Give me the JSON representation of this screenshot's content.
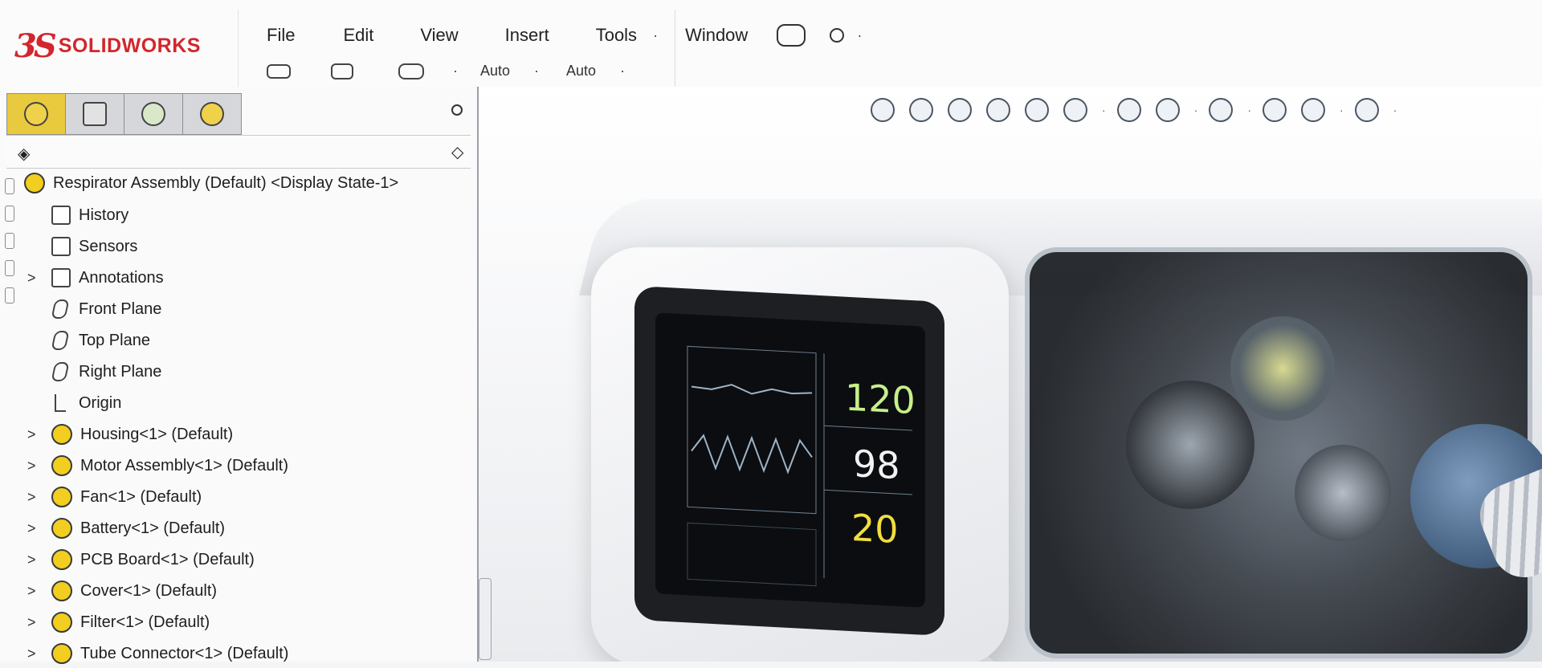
{
  "app": {
    "logo_ds": "3S",
    "logo_text": "SOLIDWORKS",
    "brand_color": "#d3262c"
  },
  "menu": {
    "items": [
      "File",
      "Edit",
      "View",
      "Insert",
      "Tools",
      "Window"
    ],
    "extra": [
      "·",
      "·"
    ],
    "sub_items": [
      "Auto",
      "Auto"
    ]
  },
  "feature_tree": {
    "root_label": "Respirator Assembly (Default) <Display State-1>",
    "rows": [
      {
        "label": "History",
        "icon": "history-icon",
        "expandable": false
      },
      {
        "label": "Sensors",
        "icon": "sensors-icon",
        "expandable": false
      },
      {
        "label": "Annotations",
        "icon": "annotations-icon",
        "expandable": true
      },
      {
        "label": "Front Plane",
        "icon": "plane-icon",
        "expandable": false
      },
      {
        "label": "Top Plane",
        "icon": "plane-icon",
        "expandable": false
      },
      {
        "label": "Right Plane",
        "icon": "plane-icon",
        "expandable": false
      },
      {
        "label": "Origin",
        "icon": "origin-icon",
        "expandable": false
      },
      {
        "label": "Housing<1> (Default)",
        "icon": "part-icon",
        "expandable": true
      },
      {
        "label": "Motor Assembly<1> (Default)",
        "icon": "part-icon",
        "expandable": true
      },
      {
        "label": "Fan<1> (Default)",
        "icon": "part-icon",
        "expandable": true
      },
      {
        "label": "Battery<1> (Default)",
        "icon": "part-icon",
        "expandable": true
      },
      {
        "label": "PCB Board<1> (Default)",
        "icon": "part-icon",
        "expandable": true
      },
      {
        "label": "Cover<1> (Default)",
        "icon": "part-icon",
        "expandable": true
      },
      {
        "label": "Filter<1> (Default)",
        "icon": "part-icon",
        "expandable": true
      },
      {
        "label": "Tube Connector<1> (Default)",
        "icon": "part-icon",
        "expandable": true
      }
    ]
  },
  "device_screen": {
    "vitals": [
      "120",
      "98",
      "20"
    ],
    "vital_colors": [
      "#c7ef8a",
      "#f2f2f2",
      "#f2de3d"
    ]
  }
}
